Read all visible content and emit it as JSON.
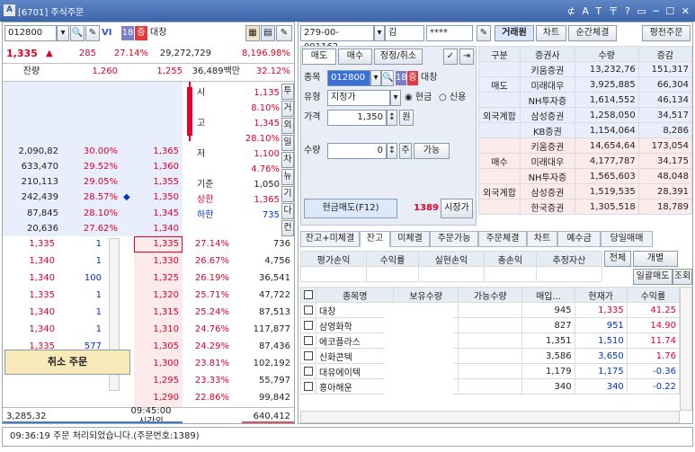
{
  "window": {
    "title": "[6701] 주식주문",
    "logo": "A",
    "controls": "⊄ A T 〒 ? ▭ ─ ☐ ✕"
  },
  "left": {
    "code": "012800",
    "vi_label": "VI",
    "badge_num": "18",
    "badge_jeung": "증",
    "stock_name": "대창",
    "summary": {
      "price": "1,335",
      "arrow": "▲",
      "change": "285",
      "rate": "27.14%",
      "volume": "29,272,729",
      "pct": "8,196.98%"
    },
    "remain_label": "잔량",
    "remain_sell": "1,260",
    "remain_price": "1,255",
    "amount": "36,489백만",
    "amount_rate": "32.12%",
    "sell_rows": [
      {
        "qty": "",
        "rate": "",
        "price": ""
      },
      {
        "qty": "",
        "rate": "",
        "price": ""
      },
      {
        "qty": "",
        "rate": "",
        "price": ""
      },
      {
        "qty": "",
        "rate": "",
        "price": ""
      },
      {
        "qty": "2,090,82",
        "rate": "30.00%",
        "price": "1,365"
      },
      {
        "qty": "633,470",
        "rate": "29.52%",
        "price": "1,360"
      },
      {
        "qty": "210,113",
        "rate": "29.05%",
        "price": "1,355"
      },
      {
        "qty": "242,439",
        "rate": "28.57%",
        "price": "1,350"
      },
      {
        "qty": "87,845",
        "rate": "28.10%",
        "price": "1,345"
      },
      {
        "qty": "20,636",
        "rate": "27.62%",
        "price": "1,340"
      }
    ],
    "info": [
      {
        "label": "시",
        "value": "1,135",
        "pct": ""
      },
      {
        "label": "",
        "value": "8.10%",
        "pct": ""
      },
      {
        "label": "고",
        "value": "1,345",
        "pct": ""
      },
      {
        "label": "",
        "value": "28.10%",
        "pct": ""
      },
      {
        "label": "저",
        "value": "1,100",
        "pct": ""
      },
      {
        "label": "",
        "value": "4.76%",
        "pct": ""
      },
      {
        "label": "기준",
        "value": "1,050",
        "pct": ""
      },
      {
        "label": "상한",
        "value": "1,365",
        "pct": ""
      },
      {
        "label": "하한",
        "value": "735",
        "pct": ""
      }
    ],
    "side_buttons": [
      "투",
      "거",
      "외",
      "일",
      "차",
      "뉴",
      "기",
      "다",
      "컨"
    ],
    "buy_rows": [
      {
        "mine": "1,335",
        "cnt": "1",
        "price": "1,335",
        "rate": "27.14%",
        "qty": "736"
      },
      {
        "mine": "1,340",
        "cnt": "1",
        "price": "1,330",
        "rate": "26.67%",
        "qty": "4,756"
      },
      {
        "mine": "1,340",
        "cnt": "100",
        "price": "1,325",
        "rate": "26.19%",
        "qty": "36,541"
      },
      {
        "mine": "1,335",
        "cnt": "1",
        "price": "1,320",
        "rate": "25.71%",
        "qty": "47,722"
      },
      {
        "mine": "1,340",
        "cnt": "1",
        "price": "1,315",
        "rate": "25.24%",
        "qty": "87,513"
      },
      {
        "mine": "1,340",
        "cnt": "1",
        "price": "1,310",
        "rate": "24.76%",
        "qty": "117,877"
      },
      {
        "mine": "1,335",
        "cnt": "577",
        "price": "1,305",
        "rate": "24.29%",
        "qty": "87,436"
      },
      {
        "mine": "",
        "cnt": "",
        "price": "1,300",
        "rate": "23.81%",
        "qty": "102,192"
      },
      {
        "mine": "",
        "cnt": "",
        "price": "1,295",
        "rate": "23.33%",
        "qty": "55,797"
      },
      {
        "mine": "",
        "cnt": "",
        "price": "1,290",
        "rate": "22.86%",
        "qty": "99,842"
      }
    ],
    "cancel_button": "취소 주문",
    "footer": {
      "left": "3,285,32",
      "time": "09:45:00",
      "session": "시간외",
      "right": "640,412"
    }
  },
  "right": {
    "account": "279-00-001162",
    "acct_name": "김",
    "password": "****",
    "top_buttons": {
      "broker": "거래원",
      "chart": "차트",
      "instant": "순간체결",
      "balance": "평천주문"
    },
    "order_tabs": [
      "매도",
      "매수",
      "정정/취소"
    ],
    "form": {
      "code_label": "종목",
      "code": "012800",
      "badge_num": "18",
      "badge_jeung": "증",
      "name": "대창",
      "type_label": "유형",
      "type": "지정가",
      "cash": "현금",
      "credit": "신용",
      "price_label": "가격",
      "price": "1,350",
      "won": "원",
      "qty_label": "수량",
      "qty": "0",
      "ju": "주",
      "avail": "가능",
      "submit": "현금매도(F12)",
      "submit_num": "1389",
      "market": "시장가"
    },
    "broker_headers": [
      "구분",
      "증권사",
      "수량",
      "증감"
    ],
    "brokers": [
      {
        "group": "",
        "name": "키움증권",
        "qty": "13,232,76",
        "chg": "151,317"
      },
      {
        "group": "매도",
        "name": "미래대우",
        "qty": "3,925,885",
        "chg": "66,304"
      },
      {
        "group": "",
        "name": "NH투자증",
        "qty": "1,614,552",
        "chg": "46,134"
      },
      {
        "group": "외국계합",
        "name": "삼성증권",
        "qty": "1,258,050",
        "chg": "34,517"
      },
      {
        "group": "",
        "name": "KB증권",
        "qty": "1,154,064",
        "chg": "8,286"
      },
      {
        "group": "",
        "name": "키움증권",
        "qty": "14,654,64",
        "chg": "173,054"
      },
      {
        "group": "매수",
        "name": "미래대우",
        "qty": "4,177,787",
        "chg": "34,175"
      },
      {
        "group": "",
        "name": "NH투자증",
        "qty": "1,565,603",
        "chg": "48,048"
      },
      {
        "group": "외국계합",
        "name": "삼성증권",
        "qty": "1,519,535",
        "chg": "28,391"
      },
      {
        "group": "",
        "name": "한국증권",
        "qty": "1,305,518",
        "chg": "18,789"
      }
    ],
    "bottom_tabs": [
      "잔고+미체결",
      "잔고",
      "미체결",
      "주문가능",
      "주문체결",
      "차트",
      "예수금",
      "당일매매"
    ],
    "summary_headers": [
      "평가손익",
      "수익률",
      "실현손익",
      "총손익",
      "추정자산"
    ],
    "filter1": "전체",
    "filter2": "개별",
    "sell_all": "일괄매도",
    "query": "조회",
    "holdings_headers": [
      "종목명",
      "보유수량",
      "가능수량",
      "매입...",
      "현재가",
      "수익률"
    ],
    "holdings": [
      {
        "name": "대창",
        "buy": "945",
        "cur": "1,335",
        "rate": "41.25"
      },
      {
        "name": "삼영화학",
        "buy": "827",
        "cur": "951",
        "rate": "14.90"
      },
      {
        "name": "에코플라스",
        "buy": "1,351",
        "cur": "1,510",
        "rate": "11.74"
      },
      {
        "name": "신화콘텍",
        "buy": "3,586",
        "cur": "3,650",
        "rate": "1.76"
      },
      {
        "name": "대유에이텍",
        "buy": "1,179",
        "cur": "1,175",
        "rate": "-0.36"
      },
      {
        "name": "홍아해운",
        "buy": "340",
        "cur": "340",
        "rate": "-0.22"
      }
    ]
  },
  "status_message": "09:36:19 주문 처리되었습니다.(주문번호:1389)"
}
